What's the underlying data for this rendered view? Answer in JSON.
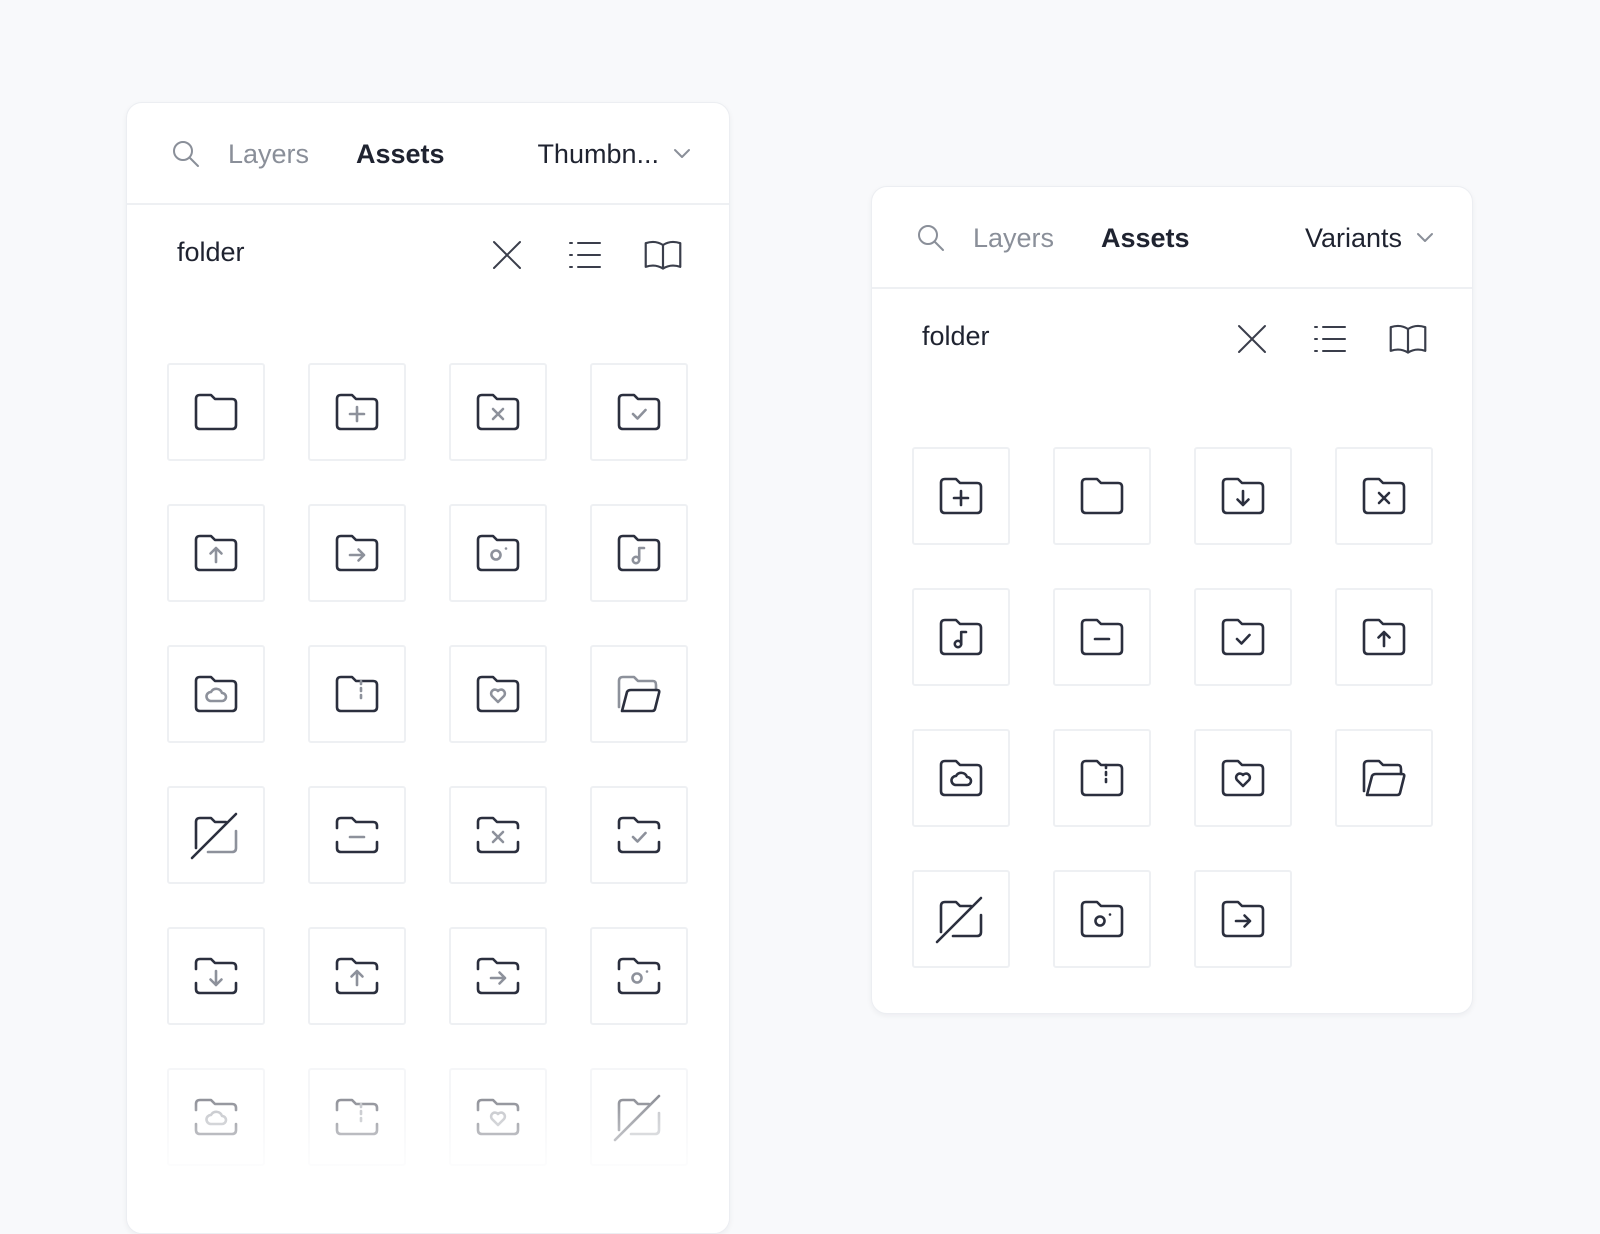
{
  "colors": {
    "background": "#f8f9fb",
    "icon_stroke": "#2b2f3e",
    "icon_accent": "#8d919b",
    "muted_text": "#8a8f99",
    "text": "#1f2330"
  },
  "left_panel": {
    "search_icon": "search-icon",
    "tabs": {
      "layers": "Layers",
      "assets": "Assets"
    },
    "view_dropdown": {
      "label": "Thumbn...",
      "icon": "chevron-down-icon"
    },
    "search_value": "folder",
    "toolbar_icons": [
      "clear-icon",
      "list-view-icon",
      "library-icon"
    ],
    "icons": [
      "folder",
      "folder-plus",
      "folder-x",
      "folder-check",
      "folder-upload",
      "folder-arrow-right",
      "folder-camera",
      "folder-music",
      "folder-cloud",
      "folder-zip",
      "folder-heart",
      "folder-open",
      "folder-off",
      "folder-minus-dashed",
      "folder-x-dashed",
      "folder-check-dashed",
      "folder-download-dashed",
      "folder-upload-dashed",
      "folder-arrow-right-dashed",
      "folder-camera-dashed",
      "folder-cloud-dashed",
      "folder-zip-dashed",
      "folder-heart-dashed",
      "folder-off-dashed"
    ]
  },
  "right_panel": {
    "search_icon": "search-icon",
    "tabs": {
      "layers": "Layers",
      "assets": "Assets"
    },
    "view_dropdown": {
      "label": "Variants",
      "icon": "chevron-down-icon"
    },
    "search_value": "folder",
    "toolbar_icons": [
      "clear-icon",
      "list-view-icon",
      "library-icon"
    ],
    "icons": [
      "folder-plus",
      "folder",
      "folder-download",
      "folder-x",
      "folder-music",
      "folder-minus",
      "folder-check",
      "folder-upload",
      "folder-cloud",
      "folder-zip",
      "folder-heart",
      "folder-open",
      "folder-off",
      "folder-camera",
      "folder-arrow-right"
    ]
  }
}
